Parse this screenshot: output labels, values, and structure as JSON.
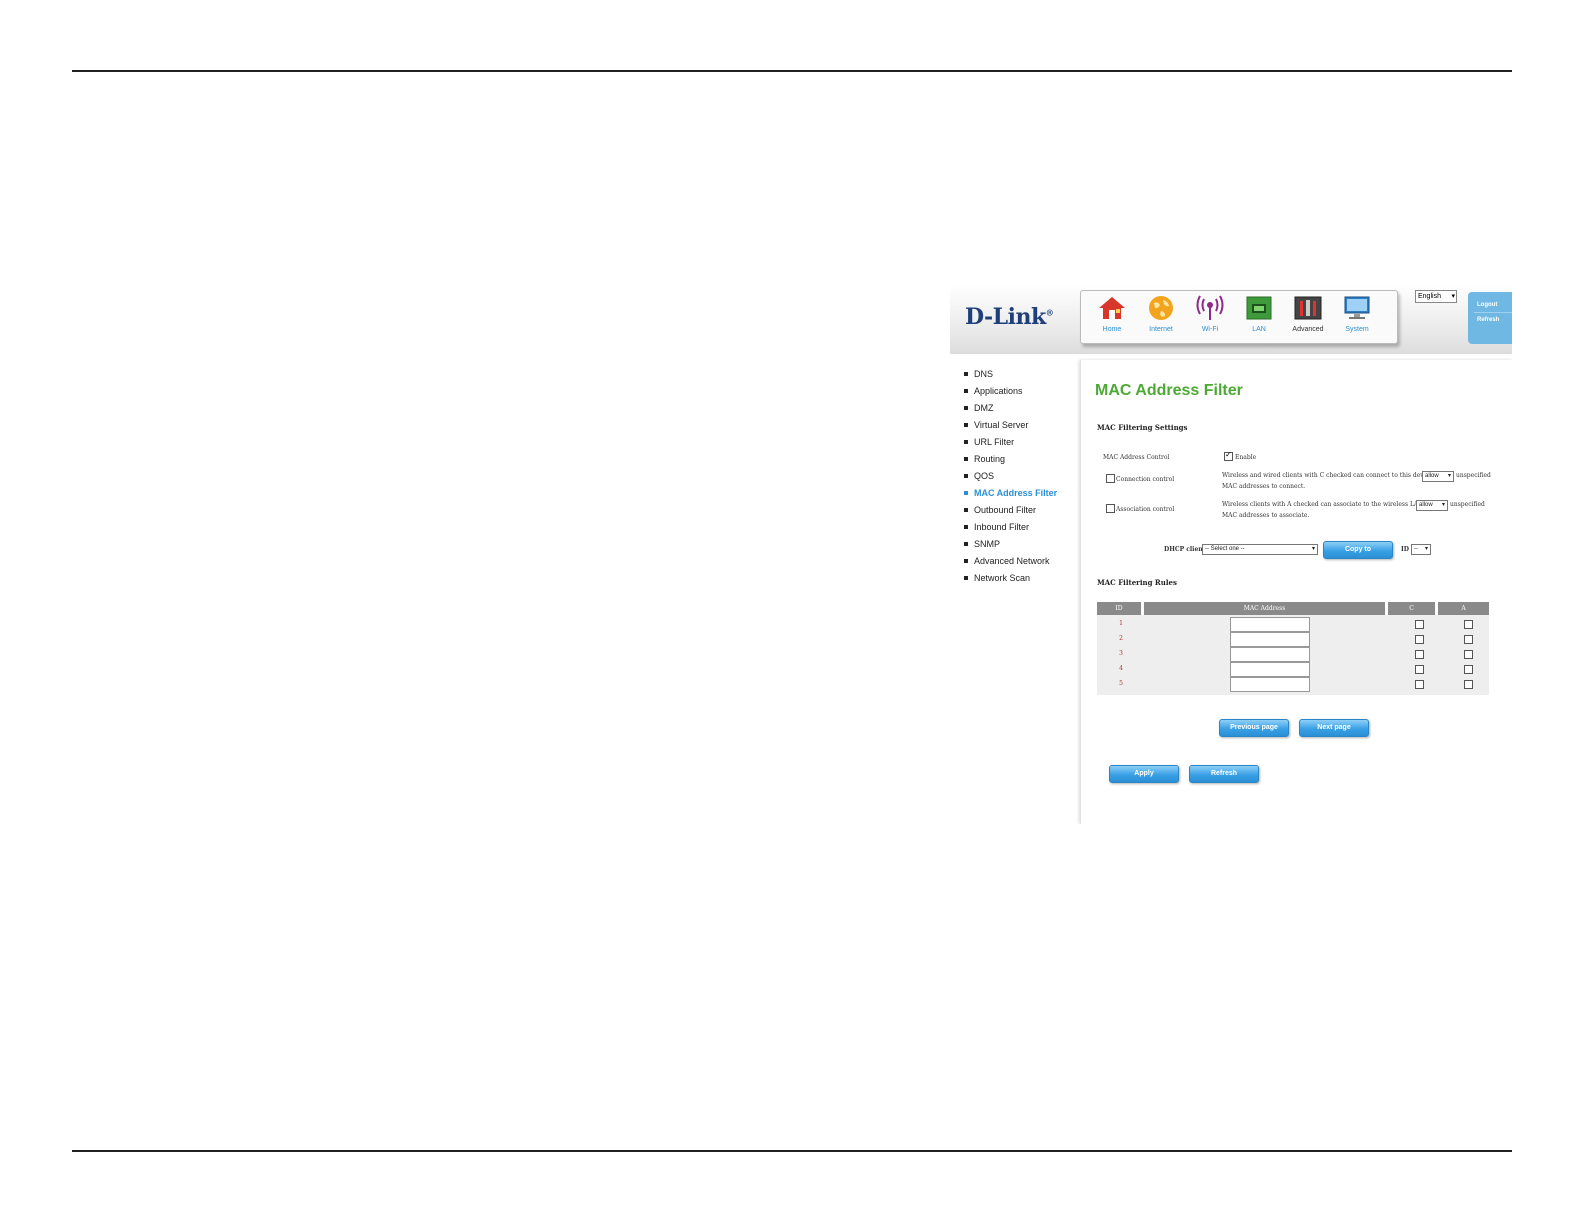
{
  "header": {
    "logo": "D-Link",
    "nav": [
      {
        "label": "Home",
        "icon": "home-icon"
      },
      {
        "label": "Internet",
        "icon": "globe-icon"
      },
      {
        "label": "Wi-Fi",
        "icon": "wifi-icon"
      },
      {
        "label": "LAN",
        "icon": "lan-icon"
      },
      {
        "label": "Advanced",
        "icon": "tools-icon"
      },
      {
        "label": "System",
        "icon": "monitor-icon"
      }
    ],
    "language": "English",
    "logout": "Logout",
    "refresh": "Refresh"
  },
  "menu": [
    {
      "label": "DNS"
    },
    {
      "label": "Applications"
    },
    {
      "label": "DMZ"
    },
    {
      "label": "Virtual Server"
    },
    {
      "label": "URL Filter"
    },
    {
      "label": "Routing"
    },
    {
      "label": "QOS"
    },
    {
      "label": "MAC Address Filter",
      "active": true
    },
    {
      "label": "Outbound Filter"
    },
    {
      "label": "Inbound Filter"
    },
    {
      "label": "SNMP"
    },
    {
      "label": "Advanced Network"
    },
    {
      "label": "Network Scan"
    }
  ],
  "page": {
    "title": "MAC Address Filter",
    "settings_heading": "MAC Filtering Settings",
    "mac_control_label": "MAC Address Control",
    "enable_label": "Enable",
    "enable_checked": true,
    "connection_label": "Connection control",
    "connection_text_1": "Wireless and wired clients with C checked can connect to this device; and",
    "connection_select": "allow",
    "connection_text_2": "unspecified",
    "connection_text_3": "MAC addresses to connect.",
    "association_label": "Association control",
    "association_text_1": "Wireless clients with A checked can associate to the wireless LAN; and",
    "association_select": "allow",
    "association_text_2": "unspecified",
    "association_text_3": "MAC addresses to associate.",
    "dhcp_label": "DHCP clients",
    "dhcp_select": "-- Select one --",
    "copy_button": "Copy to",
    "id_label": "ID",
    "id_select": "--",
    "rules_heading": "MAC Filtering Rules",
    "table": {
      "headers": [
        "ID",
        "MAC Address",
        "C",
        "A"
      ],
      "rows": [
        {
          "id": "1",
          "mac": ""
        },
        {
          "id": "2",
          "mac": ""
        },
        {
          "id": "3",
          "mac": ""
        },
        {
          "id": "4",
          "mac": ""
        },
        {
          "id": "5",
          "mac": ""
        }
      ]
    },
    "prev_button": "Previous page",
    "next_button": "Next page",
    "apply_button": "Apply",
    "refresh_button": "Refresh"
  }
}
